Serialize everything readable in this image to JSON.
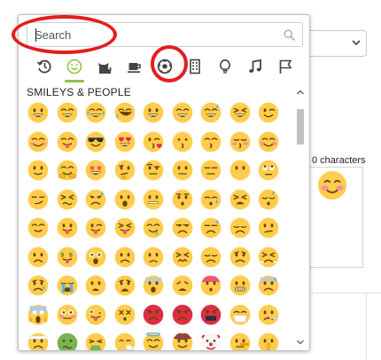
{
  "search": {
    "placeholder": "Search",
    "value": ""
  },
  "tabs": [
    {
      "name": "recent",
      "icon": "clock-history-icon"
    },
    {
      "name": "smileys-people",
      "icon": "smiley-icon",
      "active": true
    },
    {
      "name": "animals-nature",
      "icon": "cat-icon"
    },
    {
      "name": "food-drink",
      "icon": "coffee-cup-icon"
    },
    {
      "name": "activity",
      "icon": "soccer-ball-icon",
      "highlighted": true
    },
    {
      "name": "travel-places",
      "icon": "building-icon"
    },
    {
      "name": "objects",
      "icon": "lightbulb-icon"
    },
    {
      "name": "symbols",
      "icon": "music-note-icon"
    },
    {
      "name": "flags",
      "icon": "flag-icon"
    }
  ],
  "section_title": "SMILEYS & PEOPLE",
  "emojis": [
    [
      "grinning",
      "grin",
      "joy",
      "rofl",
      "smiley",
      "smile",
      "sweat-smile",
      "laughing",
      "wink"
    ],
    [
      "blush",
      "yum",
      "sunglasses",
      "heart-eyes",
      "kissing-heart",
      "kissing",
      "kissing-smiling",
      "kissing-closed",
      "relaxed"
    ],
    [
      "slight-smile",
      "hugging",
      "star-struck",
      "thinking",
      "raised-eyebrow",
      "neutral",
      "expressionless",
      "no-mouth",
      "rolling-eyes"
    ],
    [
      "smirk",
      "persevere",
      "disappointed-relieved",
      "open-mouth",
      "zipper-mouth",
      "hushed",
      "sleepy",
      "tired",
      "sleeping"
    ],
    [
      "relieved",
      "tongue",
      "winking-tongue",
      "squinting-tongue",
      "drooling",
      "unamused",
      "sweat",
      "pensive",
      "confused"
    ],
    [
      "upside-down",
      "money-mouth",
      "astonished",
      "frowning",
      "slight-frown",
      "confounded",
      "disappointed",
      "worried",
      "triumph"
    ],
    [
      "cry",
      "sob",
      "frowning-open",
      "anguished",
      "fearful",
      "weary",
      "exploding-head",
      "grimacing",
      "cold-sweat"
    ],
    [
      "scream",
      "flushed",
      "zany",
      "dizzy",
      "angry",
      "pout",
      "cursing",
      "mask",
      "thermometer"
    ],
    [
      "bandage",
      "nauseated",
      "vomiting",
      "sneezing",
      "innocent",
      "cowboy",
      "clown",
      "lying",
      "shushing"
    ]
  ],
  "background": {
    "char_count_label": "0 characters"
  },
  "colors": {
    "emoji_face": "#ffcc4d",
    "feature": "#664500",
    "accent_active": "#8bc34a",
    "annotation_ring": "#e41e1e",
    "icon_gray": "#555555"
  }
}
